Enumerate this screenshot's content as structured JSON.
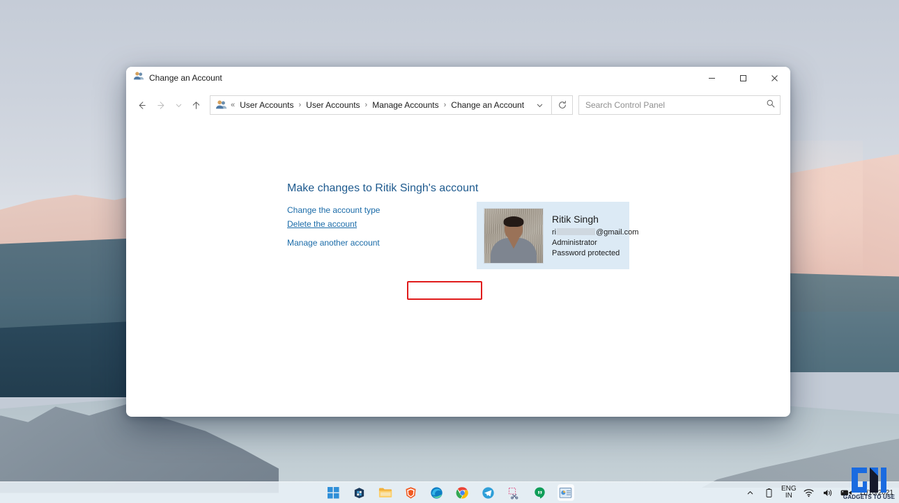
{
  "window": {
    "title": "Change an Account",
    "title_icon": "user-accounts-icon",
    "controls": {
      "minimize": "─",
      "maximize": "☐",
      "close": "✕"
    }
  },
  "nav": {
    "back": "←",
    "forward": "→",
    "recent": "∨",
    "up": "↑"
  },
  "breadcrumb": {
    "prefix": "«",
    "items": [
      "User Accounts",
      "User Accounts",
      "Manage Accounts",
      "Change an Account"
    ],
    "separator": "›",
    "chevron": "∨",
    "refresh_icon": "refresh-icon"
  },
  "search": {
    "placeholder": "Search Control Panel",
    "value": "",
    "icon": "search-icon"
  },
  "main": {
    "page_title": "Make changes to Ritik Singh's account",
    "links": [
      {
        "label": "Change the account type",
        "highlighted": false
      },
      {
        "label": "Delete the account",
        "highlighted": true
      },
      {
        "label": "Manage another account",
        "highlighted": false
      }
    ],
    "highlight_color": "#e01b1b"
  },
  "account_card": {
    "name": "Ritik Singh",
    "email_prefix": "ri",
    "email_suffix": "@gmail.com",
    "role": "Administrator",
    "password_status": "Password protected",
    "background_color": "#dceaf5"
  },
  "taskbar": {
    "apps": [
      {
        "name": "start-button",
        "label": "Start"
      },
      {
        "name": "microsoft-store",
        "label": "Microsoft Store"
      },
      {
        "name": "file-explorer",
        "label": "File Explorer"
      },
      {
        "name": "brave-browser",
        "label": "Brave"
      },
      {
        "name": "microsoft-edge",
        "label": "Microsoft Edge"
      },
      {
        "name": "google-chrome",
        "label": "Google Chrome"
      },
      {
        "name": "telegram",
        "label": "Telegram"
      },
      {
        "name": "snipping-tool",
        "label": "Snipping Tool"
      },
      {
        "name": "hangouts",
        "label": "Hangouts"
      },
      {
        "name": "control-panel",
        "label": "Control Panel"
      }
    ],
    "tray": {
      "overflow": "∧",
      "battery": "battery-icon",
      "language_line1": "ENG",
      "language_line2": "IN",
      "wifi": "wifi-icon",
      "volume": "volume-icon",
      "camera": "camera-icon",
      "date": "11/16/2021"
    }
  },
  "watermark": {
    "text": "GADGETS TO USE",
    "color": "#1a6be0"
  }
}
